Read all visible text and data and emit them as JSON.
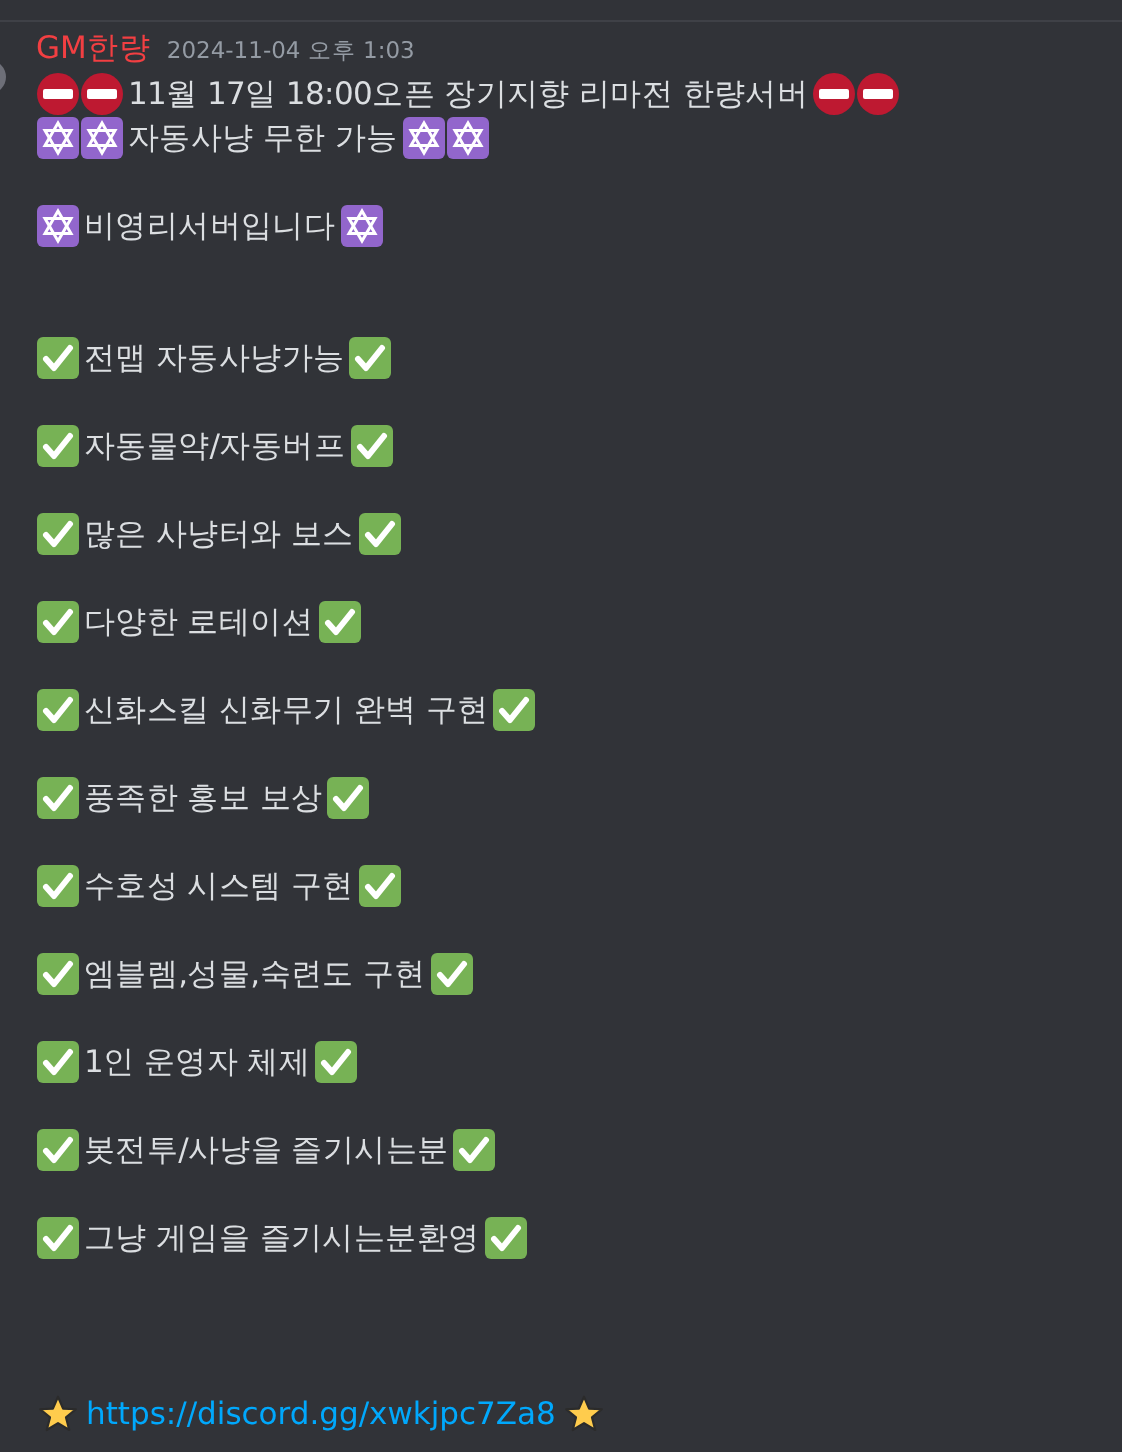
{
  "message": {
    "author": "GM한량",
    "timestamp": "2024-11-04 오후 1:03",
    "lines": [
      {
        "kind": "no-entry",
        "double": true,
        "text": "11월 17일 18:00오픈 장기지향 리마전 한량서버"
      },
      {
        "kind": "star-of-david",
        "double": true,
        "text": "자동사냥 무한 가능"
      },
      {
        "kind": "blank"
      },
      {
        "kind": "star-of-david",
        "double": false,
        "text": "비영리서버입니다"
      },
      {
        "kind": "blank"
      },
      {
        "kind": "blank"
      },
      {
        "kind": "check",
        "double": false,
        "text": "전맵 자동사냥가능"
      },
      {
        "kind": "blank"
      },
      {
        "kind": "check",
        "double": false,
        "text": "자동물약/자동버프"
      },
      {
        "kind": "blank"
      },
      {
        "kind": "check",
        "double": false,
        "text": "많은 사냥터와 보스"
      },
      {
        "kind": "blank"
      },
      {
        "kind": "check",
        "double": false,
        "text": "다양한 로테이션"
      },
      {
        "kind": "blank"
      },
      {
        "kind": "check",
        "double": false,
        "text": "신화스킬 신화무기 완벽 구현"
      },
      {
        "kind": "blank"
      },
      {
        "kind": "check",
        "double": false,
        "text": "풍족한 홍보 보상"
      },
      {
        "kind": "blank"
      },
      {
        "kind": "check",
        "double": false,
        "text": "수호성 시스템 구현"
      },
      {
        "kind": "blank"
      },
      {
        "kind": "check",
        "double": false,
        "text": "엠블렘,성물,숙련도 구현"
      },
      {
        "kind": "blank"
      },
      {
        "kind": "check",
        "double": false,
        "text": "1인 운영자 체제"
      },
      {
        "kind": "blank"
      },
      {
        "kind": "check",
        "double": false,
        "text": "봇전투/사냥을 즐기시는분"
      },
      {
        "kind": "blank"
      },
      {
        "kind": "check",
        "double": false,
        "text": "그냥 게임을 즐기시는분환영"
      },
      {
        "kind": "blank"
      },
      {
        "kind": "blank"
      },
      {
        "kind": "blank"
      },
      {
        "kind": "link",
        "double": false,
        "text": "https://discord.gg/xwkjpc7Za8"
      }
    ]
  }
}
